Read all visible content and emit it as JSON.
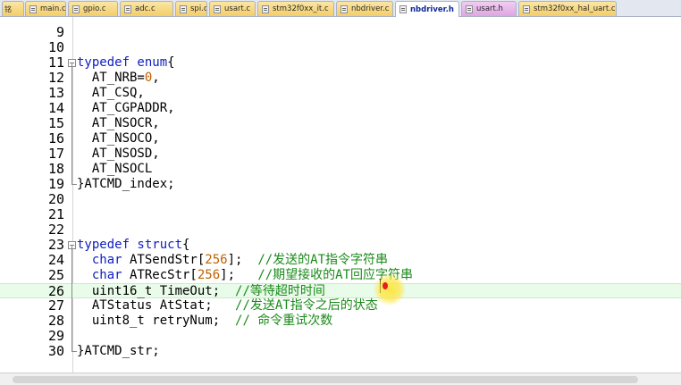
{
  "tabs": [
    {
      "label": "main.c",
      "type": "c",
      "active": false
    },
    {
      "label": "gpio.c",
      "type": "c",
      "active": false
    },
    {
      "label": "adc.c",
      "type": "c",
      "active": false
    },
    {
      "label": "spi.c",
      "type": "c",
      "active": false
    },
    {
      "label": "usart.c",
      "type": "c",
      "active": false
    },
    {
      "label": "stm32f0xx_it.c",
      "type": "c",
      "active": false
    },
    {
      "label": "nbdriver.c",
      "type": "c",
      "active": false
    },
    {
      "label": "nbdriver.h",
      "type": "h",
      "active": true
    },
    {
      "label": "usart.h",
      "type": "h",
      "active": false
    },
    {
      "label": "stm32f0xx_hal_uart.c",
      "type": "c",
      "active": false
    }
  ],
  "tab_lead_label": "铭",
  "editor": {
    "highlighted_line": 26,
    "lines": [
      {
        "n": "9",
        "parts": []
      },
      {
        "n": "10",
        "parts": []
      },
      {
        "n": "11",
        "parts": [
          [
            "kw",
            "typedef enum"
          ],
          [
            "t",
            "{"
          ]
        ]
      },
      {
        "n": "12",
        "parts": [
          [
            "t",
            "  AT_NRB="
          ],
          [
            "num",
            "0"
          ],
          [
            "t",
            ","
          ]
        ]
      },
      {
        "n": "13",
        "parts": [
          [
            "t",
            "  AT_CSQ,"
          ]
        ]
      },
      {
        "n": "14",
        "parts": [
          [
            "t",
            "  AT_CGPADDR,"
          ]
        ]
      },
      {
        "n": "15",
        "parts": [
          [
            "t",
            "  AT_NSOCR,"
          ]
        ]
      },
      {
        "n": "16",
        "parts": [
          [
            "t",
            "  AT_NSOCO,"
          ]
        ]
      },
      {
        "n": "17",
        "parts": [
          [
            "t",
            "  AT_NSOSD,"
          ]
        ]
      },
      {
        "n": "18",
        "parts": [
          [
            "t",
            "  AT_NSOCL"
          ]
        ]
      },
      {
        "n": "19",
        "parts": [
          [
            "t",
            "}ATCMD_index;"
          ]
        ]
      },
      {
        "n": "20",
        "parts": []
      },
      {
        "n": "21",
        "parts": []
      },
      {
        "n": "22",
        "parts": []
      },
      {
        "n": "23",
        "parts": [
          [
            "kw",
            "typedef struct"
          ],
          [
            "t",
            "{"
          ]
        ]
      },
      {
        "n": "24",
        "parts": [
          [
            "t",
            "  "
          ],
          [
            "kw",
            "char"
          ],
          [
            "t",
            " ATSendStr["
          ],
          [
            "num",
            "256"
          ],
          [
            "t",
            "];  "
          ],
          [
            "cm",
            "//发送的AT指令字符串"
          ]
        ]
      },
      {
        "n": "25",
        "parts": [
          [
            "t",
            "  "
          ],
          [
            "kw",
            "char"
          ],
          [
            "t",
            " ATRecStr["
          ],
          [
            "num",
            "256"
          ],
          [
            "t",
            "];   "
          ],
          [
            "cm",
            "//期望接收的AT回应字符串"
          ]
        ]
      },
      {
        "n": "26",
        "parts": [
          [
            "t",
            "  uint16_t TimeOut;  "
          ],
          [
            "cm",
            "//等待超时时间"
          ]
        ]
      },
      {
        "n": "27",
        "parts": [
          [
            "t",
            "  ATStatus AtStat;   "
          ],
          [
            "cm",
            "//发送AT指令之后的状态"
          ]
        ]
      },
      {
        "n": "28",
        "parts": [
          [
            "t",
            "  uint8_t retryNum;  "
          ],
          [
            "cm",
            "// 命令重试次数"
          ]
        ]
      },
      {
        "n": "29",
        "parts": []
      },
      {
        "n": "30",
        "parts": [
          [
            "t",
            "}ATCMD_str;"
          ]
        ]
      }
    ]
  },
  "colors": {
    "keyword": "#1020c0",
    "number": "#c06000",
    "comment": "#1a8a1a",
    "highlight": "#e9fbe9",
    "cursor_marker": "#ffe63c"
  },
  "icons": [
    "file-c-icon",
    "file-h-icon",
    "fold-collapse-icon"
  ]
}
